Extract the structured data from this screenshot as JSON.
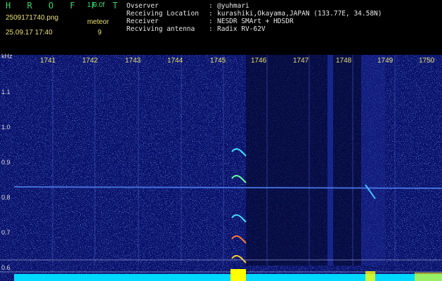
{
  "header": {
    "app_title": "H R O F F T",
    "app_version": "1.0.0f",
    "file_name": "2509171740.png",
    "date_time": "25.09.17 17:40",
    "mode_label": "meteor",
    "mode_count": "9"
  },
  "station_info": [
    {
      "key": "Ovserver",
      "value": "@yuhmari"
    },
    {
      "key": "Receiving Location",
      "value": "kurashiki,Okayama,JAPAN (133.77E, 34.58N)"
    },
    {
      "key": "Receiver",
      "value": "NESDR SMArt + HDSDR"
    },
    {
      "key": "Recviving antenna",
      "value": "Radix RV-62V"
    }
  ],
  "axis": {
    "y_unit": "kHz",
    "y_labels": [
      "1.1",
      "1.0",
      "0.9",
      "0.8",
      "0.7",
      "0.6"
    ],
    "time_labels": [
      "1741",
      "1742",
      "1743",
      "1744",
      "1745",
      "1746",
      "1747",
      "1748",
      "1749",
      "1750"
    ]
  },
  "colors": {
    "background": "#000000",
    "waterfall": "#08106a",
    "title": "#36d96a",
    "label": "#e8e070",
    "signal_bar": "#00e0ff",
    "meteor_peak": "#ffff00"
  }
}
